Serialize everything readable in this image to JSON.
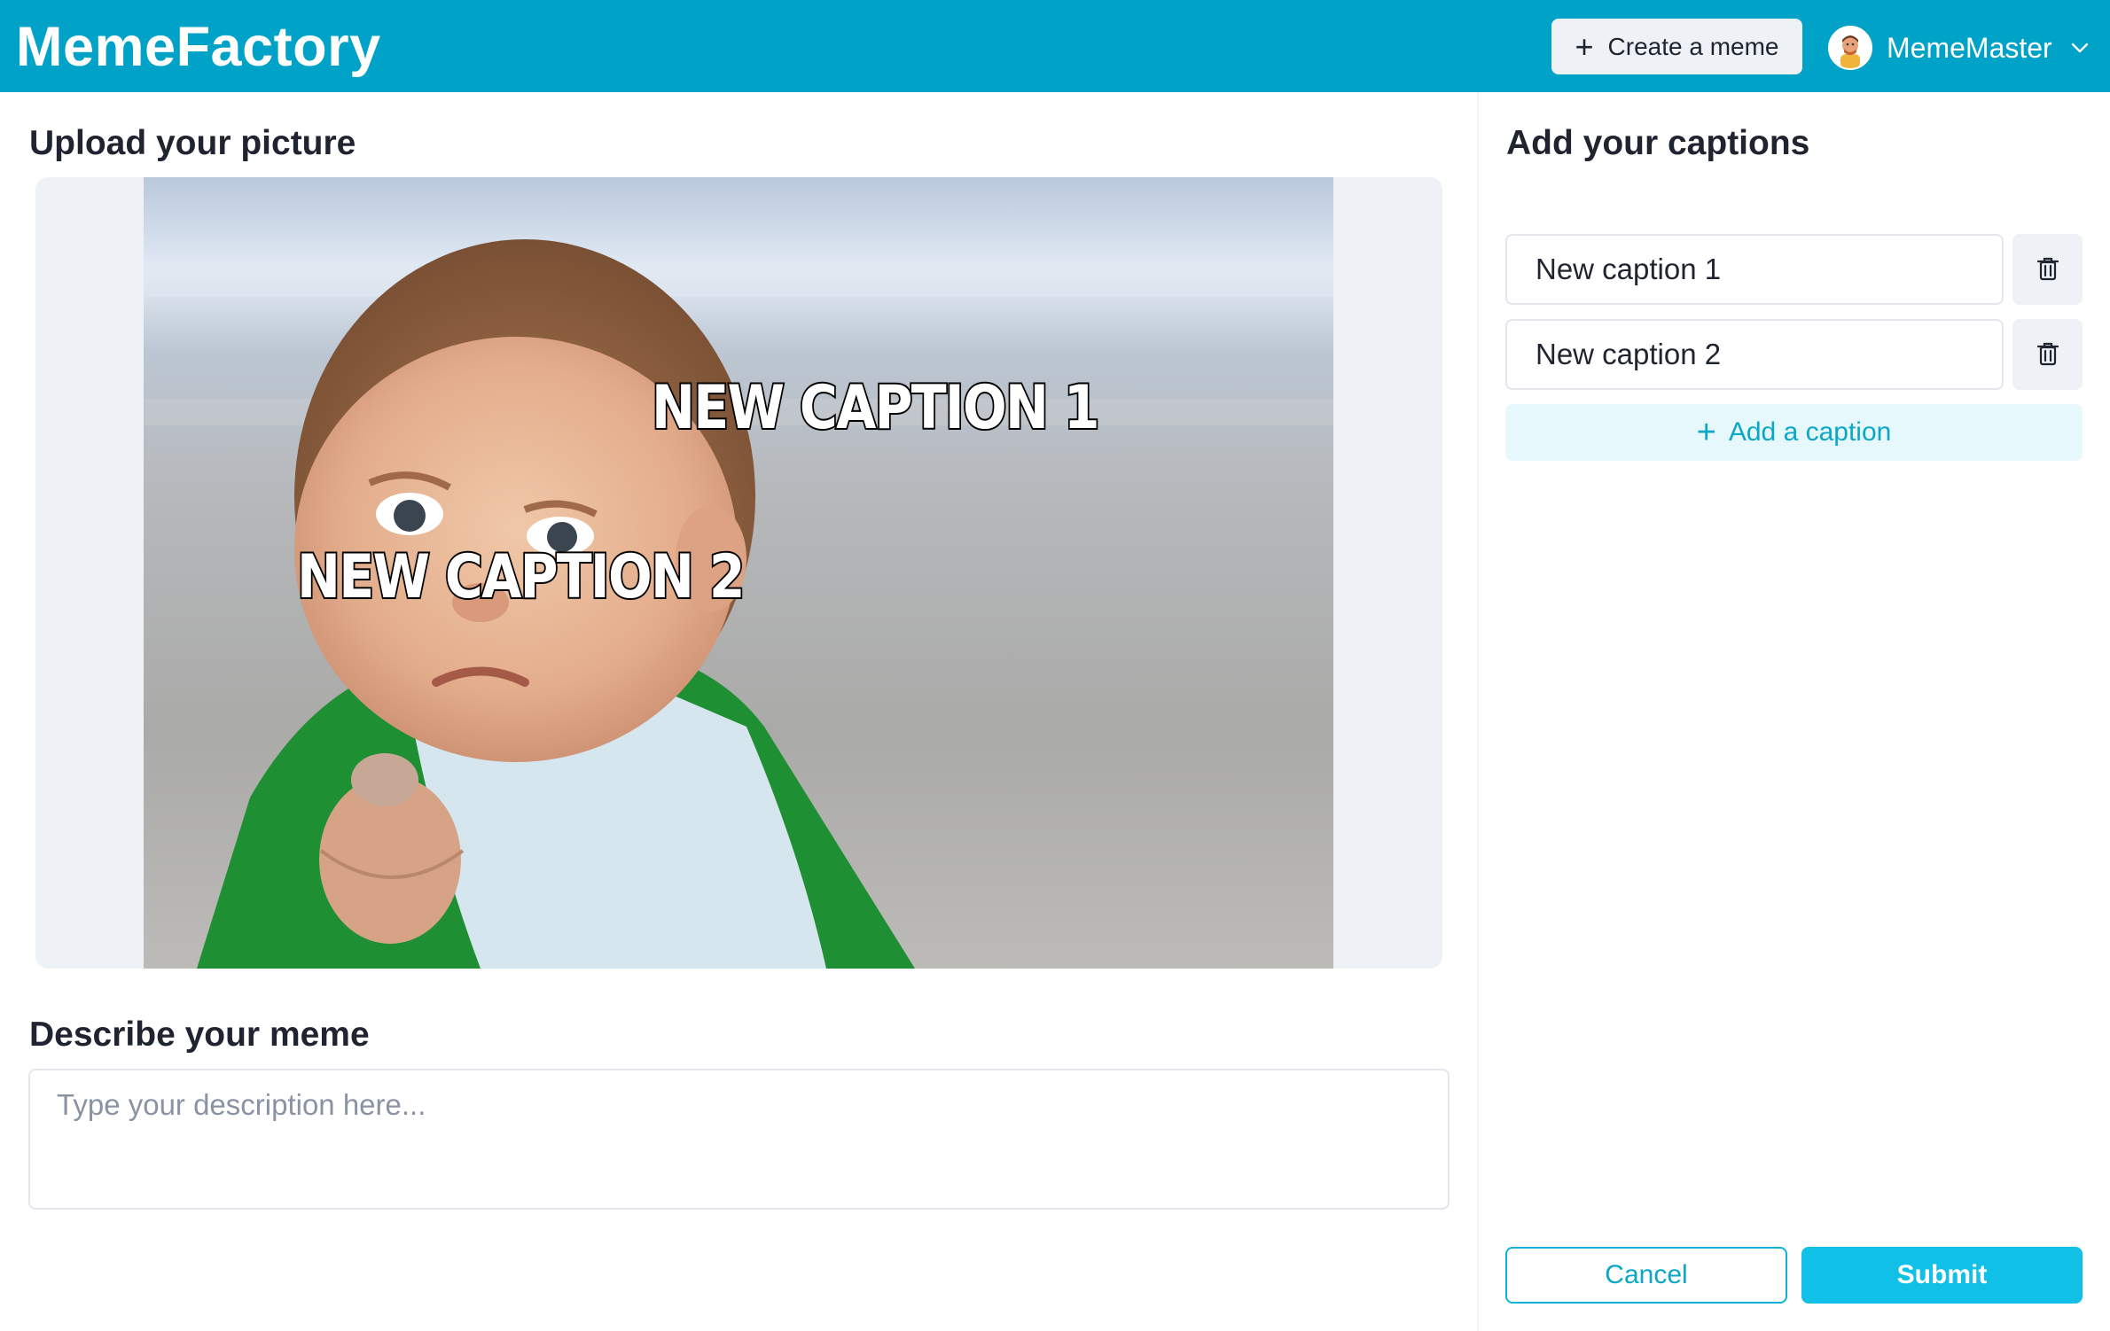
{
  "header": {
    "logo": "MemeFactory",
    "create_button_label": "Create a meme",
    "create_button_icon": "plus-icon",
    "user": {
      "name": "MemeMaster",
      "avatar_icon": "user-avatar",
      "menu_icon": "chevron-down-icon"
    },
    "background_color": "#00a2c7"
  },
  "upload": {
    "heading": "Upload your picture",
    "image_description_icon": "photo",
    "meme_captions": [
      "NEW CAPTION 1",
      "NEW CAPTION 2"
    ]
  },
  "description": {
    "heading": "Describe your meme",
    "value": "",
    "placeholder": "Type your description here..."
  },
  "captions": {
    "heading": "Add your captions",
    "items": [
      {
        "value": "New caption 1",
        "delete_icon": "trash-icon"
      },
      {
        "value": "New caption 2",
        "delete_icon": "trash-icon"
      }
    ],
    "add_label": "Add a caption",
    "add_icon": "plus-icon"
  },
  "actions": {
    "cancel_label": "Cancel",
    "submit_label": "Submit",
    "accent_color": "#10c0e6"
  }
}
